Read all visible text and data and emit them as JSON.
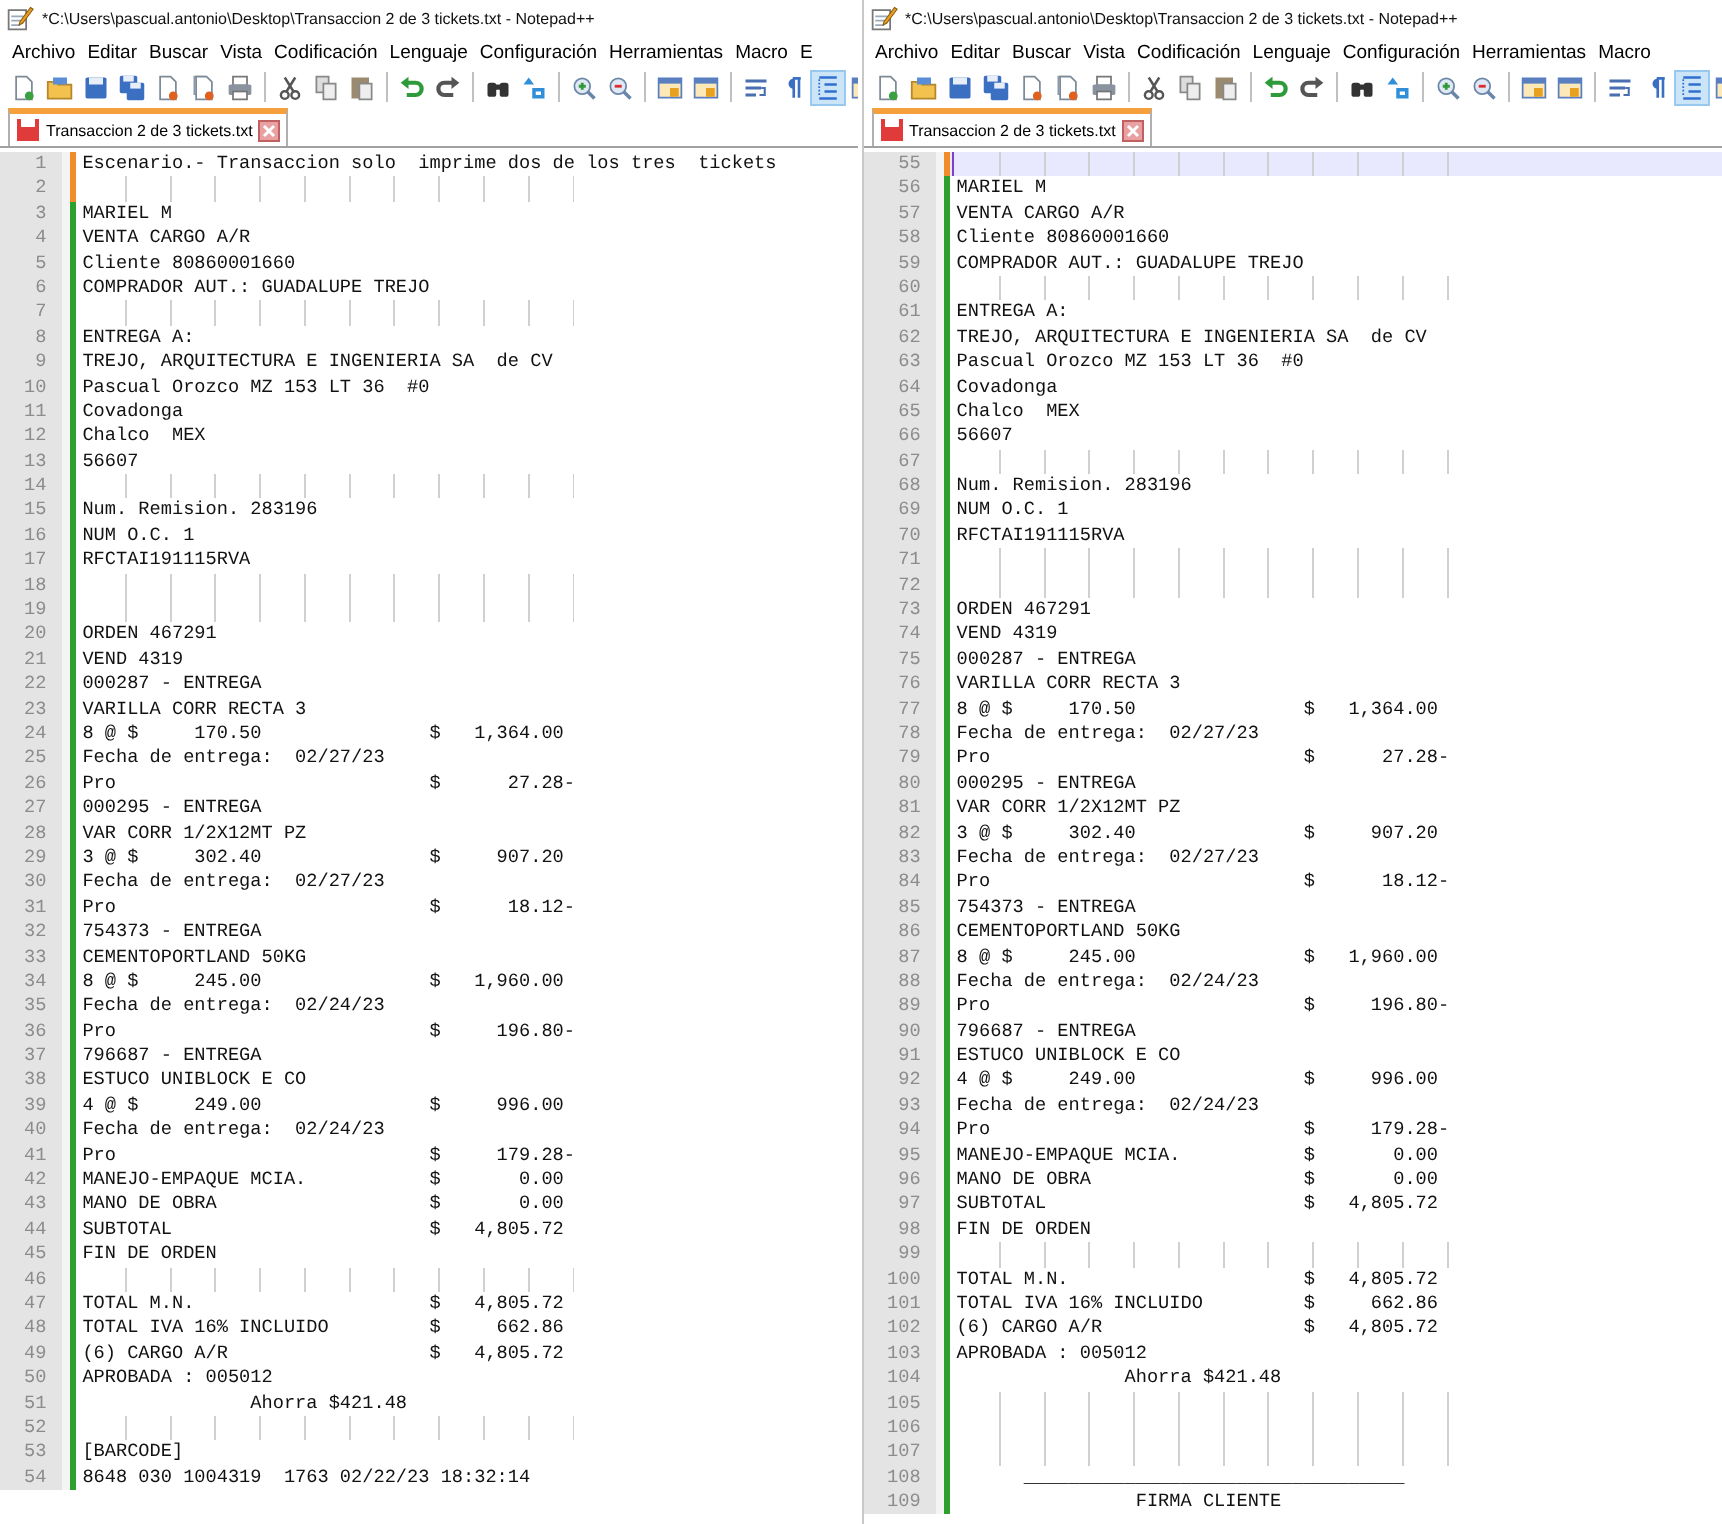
{
  "windows": [
    {
      "title": "*C:\\Users\\pascual.antonio\\Desktop\\Transaccion 2 de 3 tickets.txt - Notepad++",
      "menu": [
        "Archivo",
        "Editar",
        "Buscar",
        "Vista",
        "Codificación",
        "Lenguaje",
        "Configuración",
        "Herramientas",
        "Macro",
        "E"
      ],
      "indent_guides": true,
      "tabs": [
        {
          "label": "Transaccion 2 de 3 tickets.txt",
          "selected": true,
          "modified": true
        }
      ],
      "lines": [
        {
          "number": "1",
          "text": "Escenario.- Transaccion solo  imprime dos de los tres  tickets",
          "changed": true,
          "current": false
        },
        {
          "number": "2",
          "changed": true,
          "current": false
        },
        {
          "number": "3",
          "text": "MARIEL M",
          "changed": false,
          "current": false
        },
        {
          "number": "4",
          "text": "VENTA CARGO A/R",
          "changed": false,
          "current": false
        },
        {
          "number": "5",
          "text": "Cliente 80860001660",
          "changed": false,
          "current": false
        },
        {
          "number": "6",
          "text": "COMPRADOR AUT.: GUADALUPE TREJO",
          "changed": false,
          "current": false
        },
        {
          "number": "7",
          "changed": false,
          "current": false
        },
        {
          "number": "8",
          "text": "ENTREGA A:",
          "changed": false,
          "current": false
        },
        {
          "number": "9",
          "text": "TREJO, ARQUITECTURA E INGENIERIA SA  de CV",
          "changed": false,
          "current": false
        },
        {
          "number": "10",
          "text": "Pascual Orozco MZ 153 LT 36  #0",
          "changed": false,
          "current": false
        },
        {
          "number": "11",
          "text": "Covadonga",
          "changed": false,
          "current": false
        },
        {
          "number": "12",
          "text": "Chalco  MEX",
          "changed": false,
          "current": false
        },
        {
          "number": "13",
          "text": "56607",
          "changed": false,
          "current": false
        },
        {
          "number": "14",
          "changed": false,
          "current": false
        },
        {
          "number": "15",
          "text": "Num. Remision. 283196",
          "changed": false,
          "current": false
        },
        {
          "number": "16",
          "text": "NUM O.C. 1",
          "changed": false,
          "current": false
        },
        {
          "number": "17",
          "text": "RFCTAI191115RVA",
          "changed": false,
          "current": false
        },
        {
          "number": "18",
          "changed": false,
          "current": false
        },
        {
          "number": "19",
          "changed": false,
          "current": false
        },
        {
          "number": "20",
          "text": "ORDEN 467291",
          "changed": false,
          "current": false
        },
        {
          "number": "21",
          "text": "VEND 4319",
          "changed": false,
          "current": false
        },
        {
          "number": "22",
          "text": "000287 - ENTREGA",
          "changed": false,
          "current": false
        },
        {
          "number": "23",
          "text": "VARILLA CORR RECTA 3",
          "changed": false,
          "current": false
        },
        {
          "number": "24",
          "text": "8 @ $     170.50               $   1,364.00",
          "changed": false,
          "current": false
        },
        {
          "number": "25",
          "text": "Fecha de entrega:  02/27/23",
          "changed": false,
          "current": false
        },
        {
          "number": "26",
          "text": "Pro                            $      27.28-",
          "changed": false,
          "current": false
        },
        {
          "number": "27",
          "text": "000295 - ENTREGA",
          "changed": false,
          "current": false
        },
        {
          "number": "28",
          "text": "VAR CORR 1/2X12MT PZ",
          "changed": false,
          "current": false
        },
        {
          "number": "29",
          "text": "3 @ $     302.40               $     907.20",
          "changed": false,
          "current": false
        },
        {
          "number": "30",
          "text": "Fecha de entrega:  02/27/23",
          "changed": false,
          "current": false
        },
        {
          "number": "31",
          "text": "Pro                            $      18.12-",
          "changed": false,
          "current": false
        },
        {
          "number": "32",
          "text": "754373 - ENTREGA",
          "changed": false,
          "current": false
        },
        {
          "number": "33",
          "text": "CEMENTOPORTLAND 50KG",
          "changed": false,
          "current": false
        },
        {
          "number": "34",
          "text": "8 @ $     245.00               $   1,960.00",
          "changed": false,
          "current": false
        },
        {
          "number": "35",
          "text": "Fecha de entrega:  02/24/23",
          "changed": false,
          "current": false
        },
        {
          "number": "36",
          "text": "Pro                            $     196.80-",
          "changed": false,
          "current": false
        },
        {
          "number": "37",
          "text": "796687 - ENTREGA",
          "changed": false,
          "current": false
        },
        {
          "number": "38",
          "text": "ESTUCO UNIBLOCK E CO",
          "changed": false,
          "current": false
        },
        {
          "number": "39",
          "text": "4 @ $     249.00               $     996.00",
          "changed": false,
          "current": false
        },
        {
          "number": "40",
          "text": "Fecha de entrega:  02/24/23",
          "changed": false,
          "current": false
        },
        {
          "number": "41",
          "text": "Pro                            $     179.28-",
          "changed": false,
          "current": false
        },
        {
          "number": "42",
          "text": "MANEJO-EMPAQUE MCIA.           $       0.00",
          "changed": false,
          "current": false
        },
        {
          "number": "43",
          "text": "MANO DE OBRA                   $       0.00",
          "changed": false,
          "current": false
        },
        {
          "number": "44",
          "text": "SUBTOTAL                       $   4,805.72",
          "changed": false,
          "current": false
        },
        {
          "number": "45",
          "text": "FIN DE ORDEN",
          "changed": false,
          "current": false
        },
        {
          "number": "46",
          "changed": false,
          "current": false
        },
        {
          "number": "47",
          "text": "TOTAL M.N.                     $   4,805.72",
          "changed": false,
          "current": false
        },
        {
          "number": "48",
          "text": "TOTAL IVA 16% INCLUIDO         $     662.86",
          "changed": false,
          "current": false
        },
        {
          "number": "49",
          "text": "(6) CARGO A/R                  $   4,805.72",
          "changed": false,
          "current": false
        },
        {
          "number": "50",
          "text": "APROBADA : 005012",
          "changed": false,
          "current": false
        },
        {
          "number": "51",
          "text": "               Ahorra $421.48",
          "changed": false,
          "current": false
        },
        {
          "number": "52",
          "changed": false,
          "current": false
        },
        {
          "number": "53",
          "text": "[BARCODE]",
          "changed": false,
          "current": false
        },
        {
          "number": "54",
          "text": "8648 030 1004319  1763 02/22/23 18:32:14",
          "changed": false,
          "current": false
        }
      ]
    },
    {
      "title": "*C:\\Users\\pascual.antonio\\Desktop\\Transaccion 2 de 3 tickets.txt - Notepad++",
      "menu": [
        "Archivo",
        "Editar",
        "Buscar",
        "Vista",
        "Codificación",
        "Lenguaje",
        "Configuración",
        "Herramientas",
        "Macro"
      ],
      "indent_guides": true,
      "tabs": [
        {
          "label": "Transaccion 2 de 3 tickets.txt",
          "selected": true,
          "modified": true
        }
      ],
      "lines": [
        {
          "number": "55",
          "changed": true,
          "current": true
        },
        {
          "number": "56",
          "text": "MARIEL M",
          "changed": false,
          "current": false
        },
        {
          "number": "57",
          "text": "VENTA CARGO A/R",
          "changed": false,
          "current": false
        },
        {
          "number": "58",
          "text": "Cliente 80860001660",
          "changed": false,
          "current": false
        },
        {
          "number": "59",
          "text": "COMPRADOR AUT.: GUADALUPE TREJO",
          "changed": false,
          "current": false
        },
        {
          "number": "60",
          "changed": false,
          "current": false
        },
        {
          "number": "61",
          "text": "ENTREGA A:",
          "changed": false,
          "current": false
        },
        {
          "number": "62",
          "text": "TREJO, ARQUITECTURA E INGENIERIA SA  de CV",
          "changed": false,
          "current": false
        },
        {
          "number": "63",
          "text": "Pascual Orozco MZ 153 LT 36  #0",
          "changed": false,
          "current": false
        },
        {
          "number": "64",
          "text": "Covadonga",
          "changed": false,
          "current": false
        },
        {
          "number": "65",
          "text": "Chalco  MEX",
          "changed": false,
          "current": false
        },
        {
          "number": "66",
          "text": "56607",
          "changed": false,
          "current": false
        },
        {
          "number": "67",
          "changed": false,
          "current": false
        },
        {
          "number": "68",
          "text": "Num. Remision. 283196",
          "changed": false,
          "current": false
        },
        {
          "number": "69",
          "text": "NUM O.C. 1",
          "changed": false,
          "current": false
        },
        {
          "number": "70",
          "text": "RFCTAI191115RVA",
          "changed": false,
          "current": false
        },
        {
          "number": "71",
          "changed": false,
          "current": false
        },
        {
          "number": "72",
          "changed": false,
          "current": false
        },
        {
          "number": "73",
          "text": "ORDEN 467291",
          "changed": false,
          "current": false
        },
        {
          "number": "74",
          "text": "VEND 4319",
          "changed": false,
          "current": false
        },
        {
          "number": "75",
          "text": "000287 - ENTREGA",
          "changed": false,
          "current": false
        },
        {
          "number": "76",
          "text": "VARILLA CORR RECTA 3",
          "changed": false,
          "current": false
        },
        {
          "number": "77",
          "text": "8 @ $     170.50               $   1,364.00",
          "changed": false,
          "current": false
        },
        {
          "number": "78",
          "text": "Fecha de entrega:  02/27/23",
          "changed": false,
          "current": false
        },
        {
          "number": "79",
          "text": "Pro                            $      27.28-",
          "changed": false,
          "current": false
        },
        {
          "number": "80",
          "text": "000295 - ENTREGA",
          "changed": false,
          "current": false
        },
        {
          "number": "81",
          "text": "VAR CORR 1/2X12MT PZ",
          "changed": false,
          "current": false
        },
        {
          "number": "82",
          "text": "3 @ $     302.40               $     907.20",
          "changed": false,
          "current": false
        },
        {
          "number": "83",
          "text": "Fecha de entrega:  02/27/23",
          "changed": false,
          "current": false
        },
        {
          "number": "84",
          "text": "Pro                            $      18.12-",
          "changed": false,
          "current": false
        },
        {
          "number": "85",
          "text": "754373 - ENTREGA",
          "changed": false,
          "current": false
        },
        {
          "number": "86",
          "text": "CEMENTOPORTLAND 50KG",
          "changed": false,
          "current": false
        },
        {
          "number": "87",
          "text": "8 @ $     245.00               $   1,960.00",
          "changed": false,
          "current": false
        },
        {
          "number": "88",
          "text": "Fecha de entrega:  02/24/23",
          "changed": false,
          "current": false
        },
        {
          "number": "89",
          "text": "Pro                            $     196.80-",
          "changed": false,
          "current": false
        },
        {
          "number": "90",
          "text": "796687 - ENTREGA",
          "changed": false,
          "current": false
        },
        {
          "number": "91",
          "text": "ESTUCO UNIBLOCK E CO",
          "changed": false,
          "current": false
        },
        {
          "number": "92",
          "text": "4 @ $     249.00               $     996.00",
          "changed": false,
          "current": false
        },
        {
          "number": "93",
          "text": "Fecha de entrega:  02/24/23",
          "changed": false,
          "current": false
        },
        {
          "number": "94",
          "text": "Pro                            $     179.28-",
          "changed": false,
          "current": false
        },
        {
          "number": "95",
          "text": "MANEJO-EMPAQUE MCIA.           $       0.00",
          "changed": false,
          "current": false
        },
        {
          "number": "96",
          "text": "MANO DE OBRA                   $       0.00",
          "changed": false,
          "current": false
        },
        {
          "number": "97",
          "text": "SUBTOTAL                       $   4,805.72",
          "changed": false,
          "current": false
        },
        {
          "number": "98",
          "text": "FIN DE ORDEN",
          "changed": false,
          "current": false
        },
        {
          "number": "99",
          "changed": false,
          "current": false
        },
        {
          "number": "100",
          "text": "TOTAL M.N.                     $   4,805.72",
          "changed": false,
          "current": false
        },
        {
          "number": "101",
          "text": "TOTAL IVA 16% INCLUIDO         $     662.86",
          "changed": false,
          "current": false
        },
        {
          "number": "102",
          "text": "(6) CARGO A/R                  $   4,805.72",
          "changed": false,
          "current": false
        },
        {
          "number": "103",
          "text": "APROBADA : 005012",
          "changed": false,
          "current": false
        },
        {
          "number": "104",
          "text": "               Ahorra $421.48",
          "changed": false,
          "current": false
        },
        {
          "number": "105",
          "changed": false,
          "current": false
        },
        {
          "number": "106",
          "changed": false,
          "current": false
        },
        {
          "number": "107",
          "changed": false,
          "current": false
        },
        {
          "number": "108",
          "text": "      __________________________________",
          "changed": false,
          "current": false
        },
        {
          "number": "109",
          "text": "                FIRMA CLIENTE",
          "changed": false,
          "current": false
        }
      ]
    }
  ]
}
